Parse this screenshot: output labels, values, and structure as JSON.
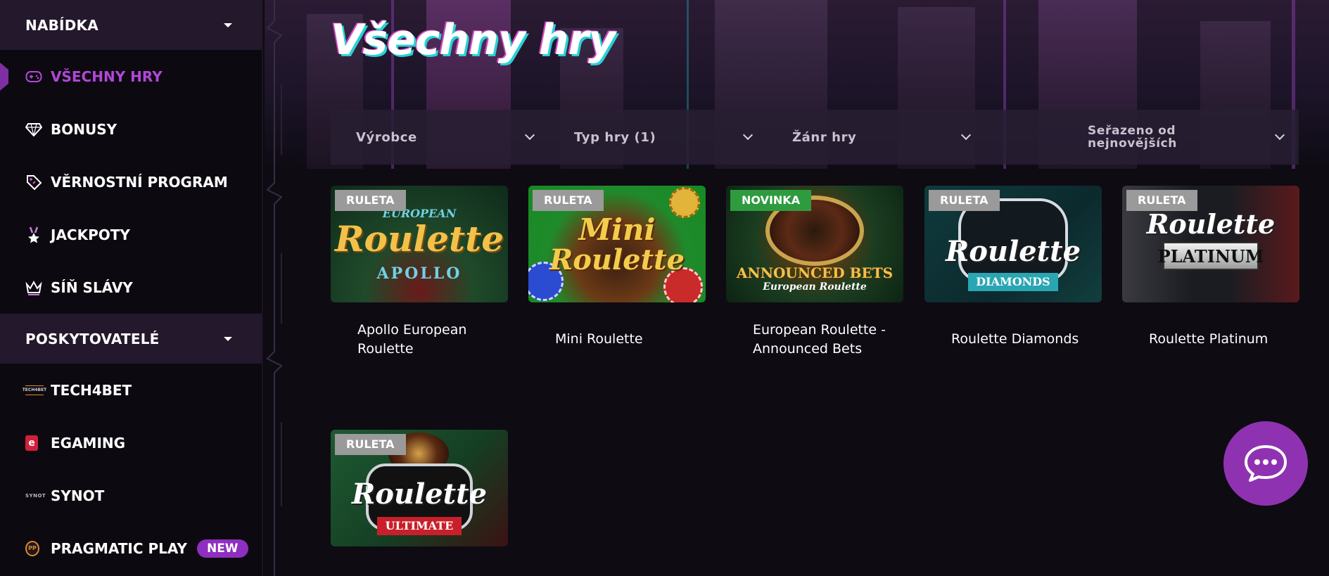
{
  "sidebar": {
    "menu_header": "NABÍDKA",
    "menu_items": [
      {
        "label": "VŠECHNY HRY",
        "icon": "gamepad-icon"
      },
      {
        "label": "BONUSY",
        "icon": "diamond-icon"
      },
      {
        "label": "VĚRNOSTNÍ PROGRAM",
        "icon": "loyalty-tag-icon"
      },
      {
        "label": "JACKPOTY",
        "icon": "medal-icon"
      },
      {
        "label": "SÍŇ SLÁVY",
        "icon": "crown-icon"
      }
    ],
    "providers_header": "POSKYTOVATELÉ",
    "provider_items": [
      {
        "label": "TECH4BET",
        "logo_text": "TECH4BET"
      },
      {
        "label": "EGAMING",
        "logo_text": "e"
      },
      {
        "label": "SYNOT",
        "logo_text": "SYNOT"
      },
      {
        "label": "PRAGMATIC PLAY",
        "badge": "NEW",
        "logo_text": "PP"
      }
    ]
  },
  "main": {
    "title": "Všechny hry",
    "filters": {
      "vendor": "Výrobce",
      "game_type": "Typ hry (1)",
      "genre": "Žánr hry",
      "sort_line1": "Seřazeno od",
      "sort_line2": "nejnovějších"
    },
    "games": [
      {
        "title": "Apollo European Roulette",
        "badge": "RULETA",
        "logo_top": "EUROPEAN",
        "logo_main": "Roulette",
        "logo_sub": "APOLLO"
      },
      {
        "title": "Mini Roulette",
        "badge": "RULETA",
        "logo_top": "Mini",
        "logo_main": "Roulette",
        "logo_sub": ""
      },
      {
        "title": "European Roulette - Announced Bets",
        "badge": "NOVINKA",
        "logo_top": "",
        "logo_main": "ANNOUNCED BETS",
        "logo_sub": "European Roulette"
      },
      {
        "title": "Roulette Diamonds",
        "badge": "RULETA",
        "logo_top": "",
        "logo_main": "Roulette",
        "logo_sub": "DIAMONDS"
      },
      {
        "title": "Roulette Platinum",
        "badge": "RULETA",
        "logo_top": "",
        "logo_main": "Roulette",
        "logo_sub": "PLATINUM"
      },
      {
        "title": "",
        "badge": "RULETA",
        "logo_top": "",
        "logo_main": "Roulette",
        "logo_sub": "ULTIMATE"
      }
    ]
  },
  "colors": {
    "accent_purple": "#8f32b2",
    "active_text": "#b147d6",
    "badge_gray": "#9a9a9a",
    "badge_green": "#2e9b3f"
  }
}
